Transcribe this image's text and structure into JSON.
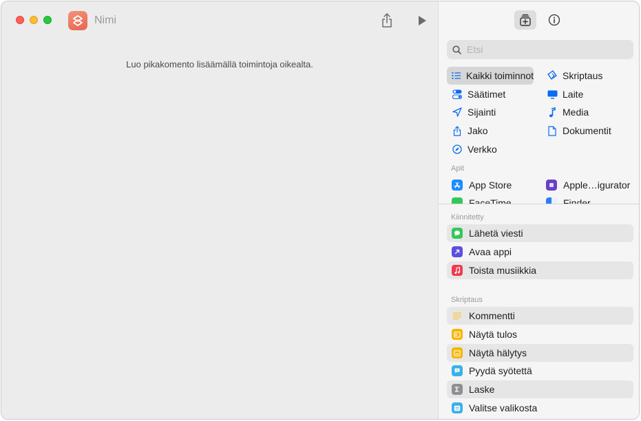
{
  "window": {
    "title": "Nimi",
    "empty_hint": "Luo pikakomento lisäämällä toimintoja oikealta."
  },
  "search": {
    "placeholder": "Etsi"
  },
  "categories": [
    {
      "label": "Kaikki toiminnot",
      "icon": "list-icon",
      "selected": true
    },
    {
      "label": "Skriptaus",
      "icon": "scripting-icon"
    },
    {
      "label": "Säätimet",
      "icon": "controls-icon"
    },
    {
      "label": "Laite",
      "icon": "device-icon"
    },
    {
      "label": "Sijainti",
      "icon": "location-icon"
    },
    {
      "label": "Media",
      "icon": "music-note-icon"
    },
    {
      "label": "Jako",
      "icon": "share-icon"
    },
    {
      "label": "Dokumentit",
      "icon": "document-icon"
    },
    {
      "label": "Verkko",
      "icon": "compass-icon"
    }
  ],
  "apps": {
    "label": "Apit",
    "items": [
      {
        "label": "App Store",
        "color": "#1a8cff"
      },
      {
        "label": "Apple…igurator",
        "color": "#6a3fc7"
      },
      {
        "label": "FaceTime",
        "color": "#34c759"
      },
      {
        "label": "Finder",
        "color": "#2d7cf6"
      }
    ]
  },
  "pinned": {
    "label": "Kiinnitetty",
    "items": [
      {
        "label": "Lähetä viesti",
        "color": "#34c759",
        "icon": "message-icon"
      },
      {
        "label": "Avaa appi",
        "color": "#5b4fe0",
        "icon": "arrow-icon"
      },
      {
        "label": "Toista musiikkia",
        "color": "#f0394d",
        "icon": "music-note-icon"
      }
    ]
  },
  "scripting": {
    "label": "Skriptaus",
    "items": [
      {
        "label": "Kommentti",
        "color": "#f5c842",
        "icon": "lines-icon"
      },
      {
        "label": "Näytä tulos",
        "color": "#f7b500",
        "icon": "result-icon"
      },
      {
        "label": "Näytä hälytys",
        "color": "#f7b500",
        "icon": "alert-icon"
      },
      {
        "label": "Pyydä syötettä",
        "color": "#3ab1e8",
        "icon": "input-icon"
      },
      {
        "label": "Laske",
        "color": "#8e8e93",
        "icon": "sigma-icon"
      },
      {
        "label": "Valitse valikosta",
        "color": "#3ab1e8",
        "icon": "menu-icon"
      }
    ]
  },
  "colors": {
    "accent": "#0a6cf0",
    "sidebar_bg": "#f5f5f5",
    "editor_bg": "#ececec"
  }
}
